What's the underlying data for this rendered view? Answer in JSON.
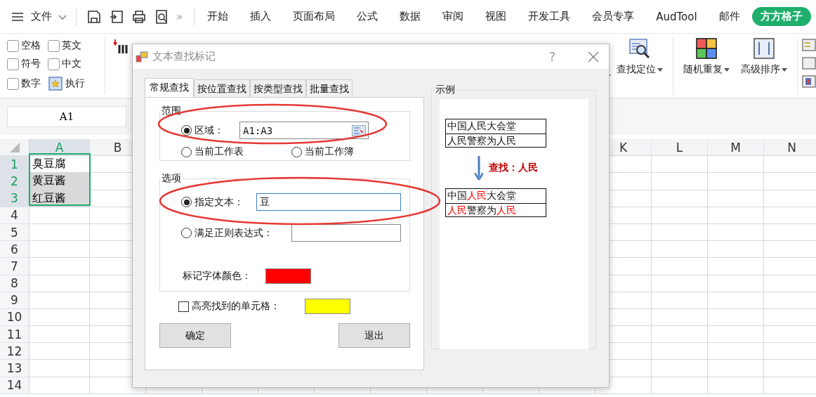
{
  "menu_bar": {
    "file_menu": "文件",
    "more": "»",
    "tabs": [
      {
        "label": "开始",
        "selected": false
      },
      {
        "label": "插入",
        "selected": false
      },
      {
        "label": "页面布局",
        "selected": false
      },
      {
        "label": "公式",
        "selected": false
      },
      {
        "label": "数据",
        "selected": false
      },
      {
        "label": "审阅",
        "selected": false
      },
      {
        "label": "视图",
        "selected": false
      },
      {
        "label": "开发工具",
        "selected": false
      },
      {
        "label": "会员专享",
        "selected": false
      },
      {
        "label": "AudTool",
        "selected": false
      },
      {
        "label": "邮件",
        "selected": false
      },
      {
        "label": "方方格子",
        "selected": true
      }
    ]
  },
  "ribbon": {
    "checkboxes": [
      {
        "label": "空格",
        "checked": false
      },
      {
        "label": "英文",
        "checked": false
      },
      {
        "label": "符号",
        "checked": false
      },
      {
        "label": "中文",
        "checked": false
      },
      {
        "label": "数字",
        "checked": false
      }
    ],
    "execute": "执行",
    "tools": [
      "查找定位",
      "随机重复",
      "高级排序"
    ]
  },
  "name_box": "A1",
  "sheet": {
    "columns": [
      {
        "label": "A",
        "selected": true
      },
      {
        "label": "B",
        "selected": false
      },
      {
        "label": "K",
        "selected": false
      },
      {
        "label": "L",
        "selected": false
      },
      {
        "label": "M",
        "selected": false
      },
      {
        "label": "N",
        "selected": false
      }
    ],
    "rows": [
      {
        "label": "1",
        "selected": true,
        "cell": "臭豆腐"
      },
      {
        "label": "2",
        "selected": true,
        "cell": "黄豆酱"
      },
      {
        "label": "3",
        "selected": true,
        "cell": "红豆酱"
      },
      {
        "label": "4",
        "selected": false
      },
      {
        "label": "5",
        "selected": false
      },
      {
        "label": "6",
        "selected": false
      },
      {
        "label": "7",
        "selected": false
      },
      {
        "label": "8",
        "selected": false
      },
      {
        "label": "9",
        "selected": false
      },
      {
        "label": "10",
        "selected": false
      },
      {
        "label": "11",
        "selected": false
      },
      {
        "label": "12",
        "selected": false
      },
      {
        "label": "13",
        "selected": false
      },
      {
        "label": "14",
        "selected": false
      }
    ]
  },
  "dialog": {
    "title": "文本查找标记",
    "help": "?",
    "tabs": [
      {
        "label": "常规查找",
        "selected": true
      },
      {
        "label": "按位置查找",
        "selected": false
      },
      {
        "label": "按类型查找",
        "selected": false
      },
      {
        "label": "批量查找",
        "selected": false
      }
    ],
    "range_group": {
      "legend": "范围",
      "area": {
        "label": "区域：",
        "selected": true,
        "value": "A1:A3"
      },
      "sheet": {
        "label": "当前工作表",
        "selected": false
      },
      "workbook": {
        "label": "当前工作簿",
        "selected": false
      }
    },
    "options_group": {
      "legend": "选项",
      "text": {
        "label": "指定文本：",
        "selected": true,
        "value": "豆"
      },
      "regex": {
        "label": "满足正则表达式：",
        "selected": false
      },
      "font_color": {
        "label": "标记字体颜色：",
        "color": "#ff0000"
      }
    },
    "highlight": {
      "label": "高亮找到的单元格：",
      "checked": false,
      "color": "#ffff00"
    },
    "buttons": [
      "确定",
      "退出"
    ],
    "example": {
      "legend": "示例",
      "before": [
        "中国人民大会堂",
        "人民警察为人民"
      ],
      "search_label": "查找：人民",
      "after": [
        "中国**人民**大会堂",
        "**人民**警察为**人民**"
      ]
    }
  }
}
